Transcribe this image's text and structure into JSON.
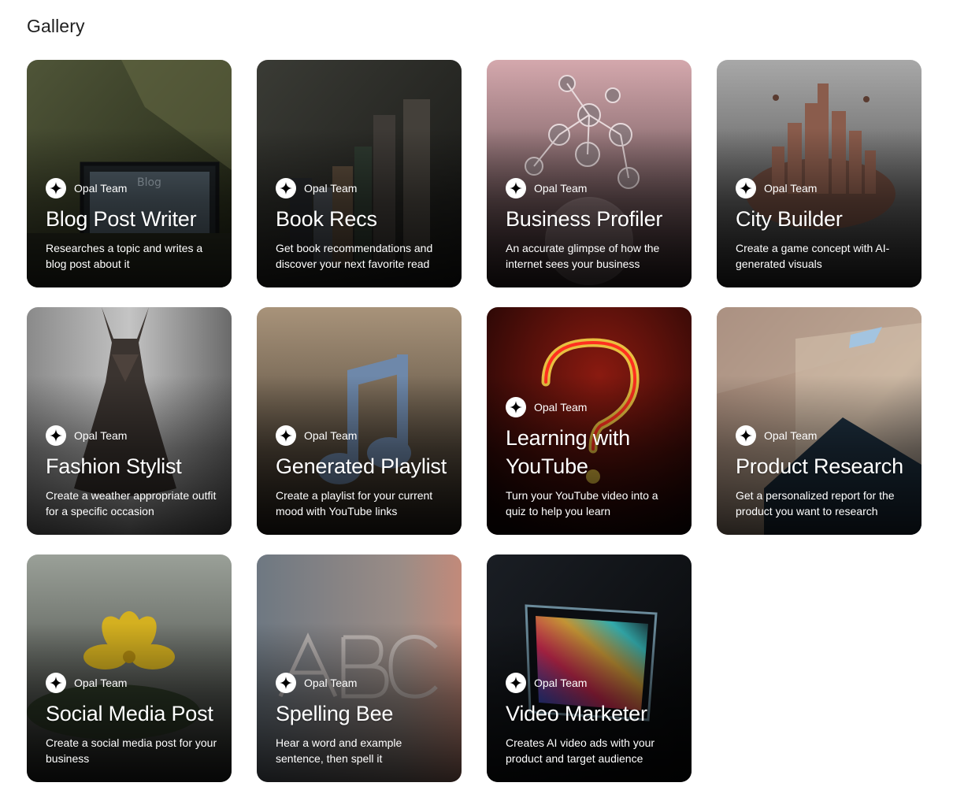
{
  "page": {
    "title": "Gallery"
  },
  "cards": [
    {
      "author": "Opal Team",
      "title": "Blog Post Writer",
      "description": "Researches a topic and writes a blog post about it",
      "bg": "#4f5538",
      "bg2": "#202414"
    },
    {
      "author": "Opal Team",
      "title": "Book Recs",
      "description": "Get book recommendations and discover your next favorite read",
      "bg": "#3a3b35",
      "bg2": "#161614"
    },
    {
      "author": "Opal Team",
      "title": "Business Profiler",
      "description": "An accurate glimpse of how the internet sees your business",
      "bg": "#c79aa0",
      "bg2": "#2e2224"
    },
    {
      "author": "Opal Team",
      "title": "City Builder",
      "description": "Create a game concept with AI-generated visuals",
      "bg": "#9a9a9a",
      "bg2": "#2b2b2b"
    },
    {
      "author": "Opal Team",
      "title": "Fashion Stylist",
      "description": "Create a weather appropriate outfit for a specific occasion",
      "bg": "#9c9c9c",
      "bg2": "#262626"
    },
    {
      "author": "Opal Team",
      "title": "Generated Playlist",
      "description": "Create a playlist for your current mood with YouTube links",
      "bg": "#9c8a6e",
      "bg2": "#2a241c"
    },
    {
      "author": "Opal Team",
      "title": "Learning with YouTube",
      "description": "Turn your YouTube video into a quiz to help you learn",
      "bg": "#6a0f0a",
      "bg2": "#140303"
    },
    {
      "author": "Opal Team",
      "title": "Product Research",
      "description": "Get a personalized report for the product you want to research",
      "bg": "#b49a86",
      "bg2": "#1d2430"
    },
    {
      "author": "Opal Team",
      "title": "Social Media Post",
      "description": "Create a social media post for your business",
      "bg": "#8a9088",
      "bg2": "#252724"
    },
    {
      "author": "Opal Team",
      "title": "Spelling Bee",
      "description": "Hear a word and example sentence, then spell it",
      "bg": "#7d8690",
      "bg2": "#2a2622"
    },
    {
      "author": "Opal Team",
      "title": "Video Marketer",
      "description": "Creates AI video ads with your product and target audience",
      "bg": "#111419",
      "bg2": "#050607"
    }
  ],
  "icons": {
    "author_icon": "sparkle-icon"
  }
}
